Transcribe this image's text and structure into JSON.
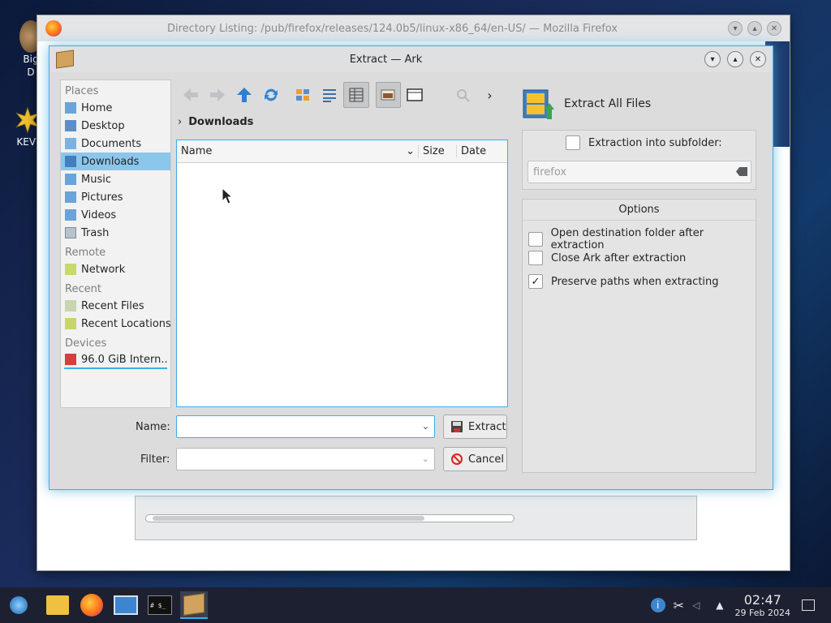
{
  "desktop": {
    "icons": [
      {
        "label": "Big\nD"
      },
      {
        "label": "KEVI"
      }
    ]
  },
  "firefox": {
    "title": "Directory Listing: /pub/firefox/releases/124.0b5/linux-x86_64/en-US/ — Mozilla Firefox"
  },
  "dialog": {
    "title": "Extract — Ark",
    "places": {
      "sections": [
        {
          "header": "Places",
          "items": [
            "Home",
            "Desktop",
            "Documents",
            "Downloads",
            "Music",
            "Pictures",
            "Videos",
            "Trash"
          ]
        },
        {
          "header": "Remote",
          "items": [
            "Network"
          ]
        },
        {
          "header": "Recent",
          "items": [
            "Recent Files",
            "Recent Locations"
          ]
        },
        {
          "header": "Devices",
          "items": [
            "96.0 GiB Intern..."
          ]
        }
      ],
      "active": "Downloads"
    },
    "breadcrumb": "Downloads",
    "columns": [
      "Name",
      "Size",
      "Date"
    ],
    "name_label": "Name:",
    "name_value": "",
    "filter_label": "Filter:",
    "extract_button": "Extract",
    "cancel_button": "Cancel",
    "right": {
      "heading": "Extract All Files",
      "subfolder_label": "Extraction into subfolder:",
      "subfolder_checked": false,
      "subfolder_value": "firefox",
      "options_header": "Options",
      "options": [
        {
          "label": "Open destination folder after extraction",
          "checked": false
        },
        {
          "label": "Close Ark after extraction",
          "checked": false
        },
        {
          "label": "Preserve paths when extracting",
          "checked": true
        }
      ]
    }
  },
  "taskbar": {
    "time": "02:47",
    "date": "29 Feb 2024",
    "terminal_text": "# $_"
  },
  "colors": {
    "accent": "#3daee9",
    "selection": "#8cc6ea",
    "taskbar": "#1c2030"
  }
}
